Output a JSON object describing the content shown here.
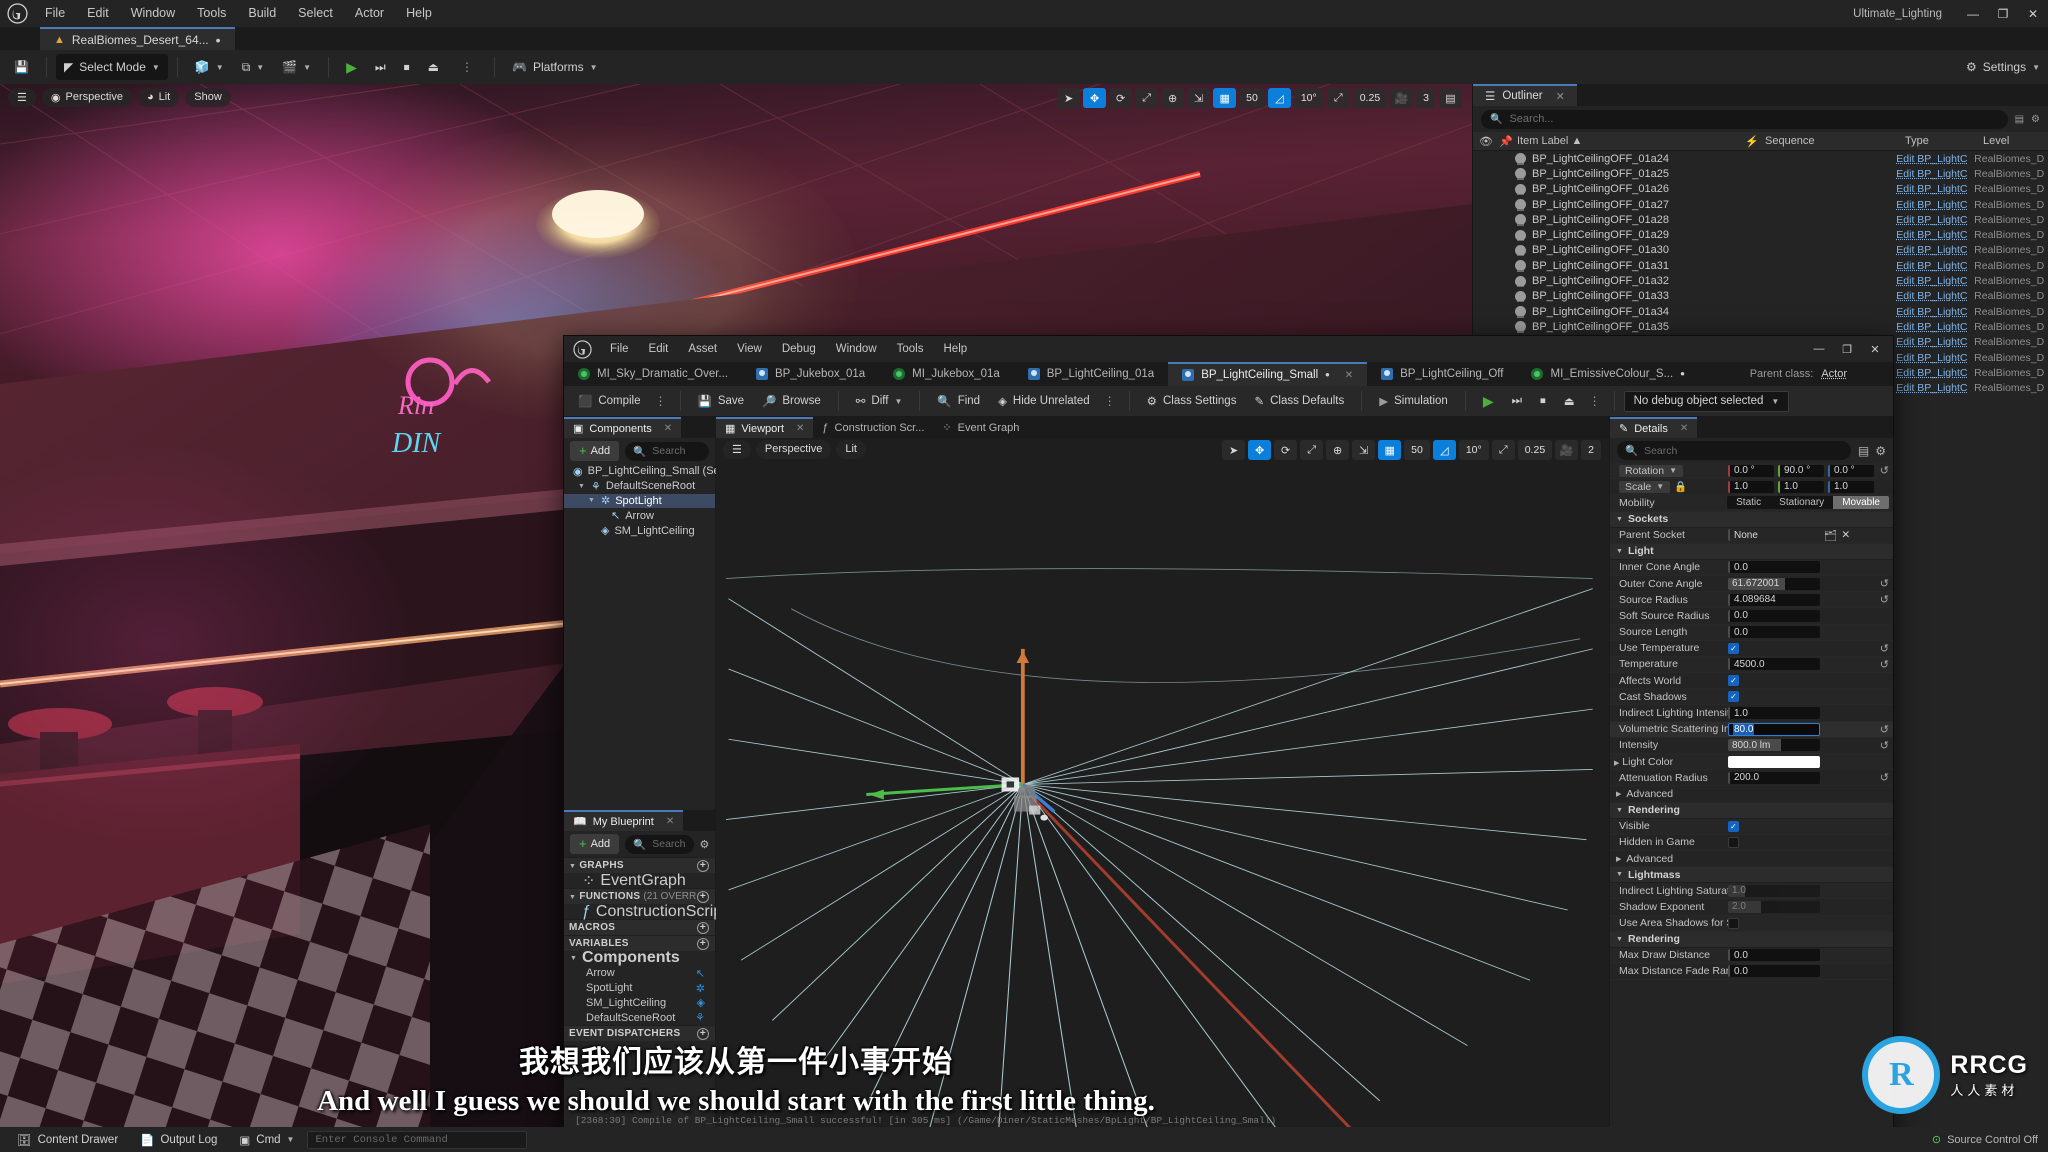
{
  "app": {
    "menu": [
      "File",
      "Edit",
      "Window",
      "Tools",
      "Build",
      "Select",
      "Actor",
      "Help"
    ],
    "level_tab": "RealBiomes_Desert_64...",
    "level_tab_dirty": "•",
    "profile_label": "Ultimate_Lighting",
    "window_controls": {
      "minimize": "—",
      "maximize": "❐",
      "close": "✕"
    }
  },
  "toolbar": {
    "save_label": "",
    "mode_label": "Select Mode",
    "platforms_label": "Platforms",
    "settings_label": "Settings",
    "caret": "⌄"
  },
  "viewport": {
    "perspective": "Perspective",
    "lit": "Lit",
    "show": "Show",
    "grid_value": "50",
    "angle_value": "10°",
    "scale_value": "0.25",
    "camera_value": "3"
  },
  "outliner": {
    "tab_label": "Outliner",
    "close": "✕",
    "search_placeholder": "Search...",
    "columns": [
      "Item Label",
      "Sequence",
      "Type",
      "Level"
    ],
    "sort_arrow": "▲",
    "rows": [
      {
        "label": "BP_LightCeilingOFF_01a24",
        "sequence": "",
        "type": "Edit BP_LightC",
        "level": "RealBiomes_D"
      },
      {
        "label": "BP_LightCeilingOFF_01a25",
        "sequence": "",
        "type": "Edit BP_LightC",
        "level": "RealBiomes_D"
      },
      {
        "label": "BP_LightCeilingOFF_01a26",
        "sequence": "",
        "type": "Edit BP_LightC",
        "level": "RealBiomes_D"
      },
      {
        "label": "BP_LightCeilingOFF_01a27",
        "sequence": "",
        "type": "Edit BP_LightC",
        "level": "RealBiomes_D"
      },
      {
        "label": "BP_LightCeilingOFF_01a28",
        "sequence": "",
        "type": "Edit BP_LightC",
        "level": "RealBiomes_D"
      },
      {
        "label": "BP_LightCeilingOFF_01a29",
        "sequence": "",
        "type": "Edit BP_LightC",
        "level": "RealBiomes_D"
      },
      {
        "label": "BP_LightCeilingOFF_01a30",
        "sequence": "",
        "type": "Edit BP_LightC",
        "level": "RealBiomes_D"
      },
      {
        "label": "BP_LightCeilingOFF_01a31",
        "sequence": "",
        "type": "Edit BP_LightC",
        "level": "RealBiomes_D"
      },
      {
        "label": "BP_LightCeilingOFF_01a32",
        "sequence": "",
        "type": "Edit BP_LightC",
        "level": "RealBiomes_D"
      },
      {
        "label": "BP_LightCeilingOFF_01a33",
        "sequence": "",
        "type": "Edit BP_LightC",
        "level": "RealBiomes_D"
      },
      {
        "label": "BP_LightCeilingOFF_01a34",
        "sequence": "",
        "type": "Edit BP_LightC",
        "level": "RealBiomes_D"
      },
      {
        "label": "BP_LightCeilingOFF_01a35",
        "sequence": "",
        "type": "Edit BP_LightC",
        "level": "RealBiomes_D"
      },
      {
        "label": "",
        "sequence": "",
        "type": "Edit BP_LightC",
        "level": "RealBiomes_D"
      },
      {
        "label": "",
        "sequence": "",
        "type": "Edit BP_LightC",
        "level": "RealBiomes_D"
      },
      {
        "label": "",
        "sequence": "",
        "type": "Edit BP_LightC",
        "level": "RealBiomes_D"
      },
      {
        "label": "",
        "sequence": "",
        "type": "Edit BP_LightC",
        "level": "RealBiomes_D"
      }
    ]
  },
  "blueprint": {
    "menu": [
      "File",
      "Edit",
      "Asset",
      "View",
      "Debug",
      "Window",
      "Tools",
      "Help"
    ],
    "asset_tabs": [
      {
        "label": "MI_Sky_Dramatic_Over...",
        "icon": "material-icon",
        "active": false,
        "dirty": false
      },
      {
        "label": "BP_Jukebox_01a",
        "icon": "blueprint-icon",
        "active": false,
        "dirty": false
      },
      {
        "label": "MI_Jukebox_01a",
        "icon": "material-icon",
        "active": false,
        "dirty": false
      },
      {
        "label": "BP_LightCeiling_01a",
        "icon": "blueprint-icon",
        "active": false,
        "dirty": false
      },
      {
        "label": "BP_LightCeiling_Small",
        "icon": "blueprint-icon",
        "active": true,
        "dirty": true
      },
      {
        "label": "BP_LightCeiling_Off",
        "icon": "blueprint-icon",
        "active": false,
        "dirty": false
      },
      {
        "label": "MI_EmissiveColour_S...",
        "icon": "material-icon",
        "active": false,
        "dirty": true
      }
    ],
    "parent_class_label": "Parent class:",
    "parent_class_value": "Actor",
    "toolbar": {
      "compile": "Compile",
      "save": "Save",
      "browse": "Browse",
      "diff": "Diff",
      "find": "Find",
      "hide_unrelated": "Hide Unrelated",
      "class_settings": "Class Settings",
      "class_defaults": "Class Defaults",
      "simulation": "Simulation",
      "debug_object": "No debug object selected"
    },
    "components": {
      "tab_label": "Components",
      "add_label": "Add",
      "search_placeholder": "Search",
      "tree": [
        {
          "label": "BP_LightCeiling_Small (Self)",
          "depth": 0,
          "icon": "actor-icon",
          "selected": false,
          "twisty": ""
        },
        {
          "label": "DefaultSceneRoot",
          "depth": 1,
          "icon": "scene-root-icon",
          "selected": false,
          "twisty": "▼"
        },
        {
          "label": "SpotLight",
          "depth": 2,
          "icon": "spotlight-icon",
          "selected": true,
          "twisty": "▼"
        },
        {
          "label": "Arrow",
          "depth": 3,
          "icon": "arrow-icon",
          "selected": false,
          "twisty": ""
        },
        {
          "label": "SM_LightCeiling",
          "depth": 2,
          "icon": "static-mesh-icon",
          "selected": false,
          "twisty": ""
        }
      ]
    },
    "my_blueprint": {
      "tab_label": "My Blueprint",
      "add_label": "Add",
      "search_placeholder": "Search",
      "sections": [
        {
          "name": "GRAPHS",
          "suffix": "",
          "items": [
            {
              "label": "EventGraph",
              "icon": "event-graph-icon"
            }
          ]
        },
        {
          "name": "FUNCTIONS",
          "suffix": "(21 OVERR",
          "items": [
            {
              "label": "ConstructionScript",
              "icon": "function-icon"
            }
          ]
        },
        {
          "name": "MACROS",
          "suffix": "",
          "items": []
        },
        {
          "name": "VARIABLES",
          "suffix": "",
          "items": []
        }
      ],
      "components_group": "Components",
      "component_vars": [
        {
          "label": "Arrow",
          "icon": "arrow-icon"
        },
        {
          "label": "SpotLight",
          "icon": "spotlight-icon"
        },
        {
          "label": "SM_LightCeiling",
          "icon": "static-mesh-icon"
        },
        {
          "label": "DefaultSceneRoot",
          "icon": "scene-root-icon"
        }
      ],
      "event_dispatchers": "EVENT DISPATCHERS"
    },
    "viewport_tabs": [
      {
        "label": "Viewport",
        "active": true,
        "closable": true,
        "icon": "viewport-icon"
      },
      {
        "label": "Construction Scr...",
        "active": false,
        "closable": false,
        "icon": "function-icon"
      },
      {
        "label": "Event Graph",
        "active": false,
        "closable": false,
        "icon": "event-graph-icon"
      }
    ],
    "viewport": {
      "perspective": "Perspective",
      "lit": "Lit",
      "grid_value": "50",
      "angle_value": "10°",
      "scale_value": "0.25",
      "camera_value": "2"
    },
    "details": {
      "tab_label": "Details",
      "close": "✕",
      "search_placeholder": "Search",
      "transform": [
        {
          "name": "Rotation",
          "type": "vector3",
          "values": [
            "0.0 °",
            "90.0 °",
            "0.0 °"
          ],
          "dropdown": "⌄",
          "lock": false,
          "reset": true
        },
        {
          "name": "Scale",
          "type": "vector3",
          "values": [
            "1.0",
            "1.0",
            "1.0"
          ],
          "dropdown": "⌄",
          "lock": true,
          "reset": false
        }
      ],
      "mobility": {
        "label": "Mobility",
        "options": [
          "Static",
          "Stationary",
          "Movable"
        ],
        "selected": "Movable"
      },
      "sections": [
        {
          "title": "Sockets",
          "expanded": true,
          "rows": [
            {
              "name": "Parent Socket",
              "type": "socket",
              "value": "None",
              "reset": false
            }
          ]
        },
        {
          "title": "Light",
          "expanded": true,
          "rows": [
            {
              "name": "Inner Cone Angle",
              "type": "number",
              "value": "0.0",
              "reset": false
            },
            {
              "name": "Outer Cone Angle",
              "type": "slider",
              "value": "61.672001",
              "fill": 62,
              "reset": true
            },
            {
              "name": "Source Radius",
              "type": "number",
              "value": "4.089684",
              "reset": true
            },
            {
              "name": "Soft Source Radius",
              "type": "number",
              "value": "0.0",
              "reset": false
            },
            {
              "name": "Source Length",
              "type": "number",
              "value": "0.0",
              "reset": false
            },
            {
              "name": "Use Temperature",
              "type": "check",
              "value": true,
              "reset": true
            },
            {
              "name": "Temperature",
              "type": "number",
              "value": "4500.0",
              "reset": true
            },
            {
              "name": "Affects World",
              "type": "check",
              "value": true,
              "reset": false
            },
            {
              "name": "Cast Shadows",
              "type": "check",
              "value": true,
              "reset": false
            },
            {
              "name": "Indirect Lighting Intensity",
              "type": "number",
              "value": "1.0",
              "reset": false
            },
            {
              "name": "Volumetric Scattering Intensity",
              "type": "editing",
              "value": "80.0",
              "reset": true
            },
            {
              "name": "Intensity",
              "type": "slider",
              "value": "800.0 lm",
              "fill": 58,
              "reset": true
            },
            {
              "name": "Light Color",
              "type": "color",
              "value": "#ffffff",
              "expandable": true,
              "reset": false
            },
            {
              "name": "Attenuation Radius",
              "type": "number",
              "value": "200.0",
              "reset": true
            },
            {
              "name": "Advanced",
              "type": "subsection",
              "value": "",
              "reset": false
            }
          ]
        },
        {
          "title": "Rendering",
          "expanded": true,
          "rows": [
            {
              "name": "Visible",
              "type": "check",
              "value": true,
              "reset": false
            },
            {
              "name": "Hidden in Game",
              "type": "check",
              "value": false,
              "reset": false
            },
            {
              "name": "Advanced",
              "type": "subsection",
              "value": "",
              "reset": false
            }
          ]
        },
        {
          "title": "Lightmass",
          "expanded": true,
          "rows": [
            {
              "name": "Indirect Lighting Saturation",
              "type": "slider-dim",
              "value": "1.0",
              "fill": 18,
              "reset": false
            },
            {
              "name": "Shadow Exponent",
              "type": "slider-dim",
              "value": "2.0",
              "fill": 36,
              "reset": false
            },
            {
              "name": "Use Area Shadows for Station...",
              "type": "check",
              "value": false,
              "reset": false
            }
          ]
        },
        {
          "title": "Rendering",
          "expanded": true,
          "rows": [
            {
              "name": "Max Draw Distance",
              "type": "number",
              "value": "0.0",
              "reset": false
            },
            {
              "name": "Max Distance Fade Range",
              "type": "number",
              "value": "0.0",
              "reset": false
            }
          ]
        }
      ]
    },
    "log_line": "[2368:30] Compile of BP_LightCeiling_Small successful! [in 305 ms] (/Game/Diner/StaticMeshes/BpLight/BP_LightCeiling_Small)"
  },
  "status_bar": {
    "content_drawer": "Content Drawer",
    "output_log": "Output Log",
    "cmd": "Cmd",
    "console_placeholder": "Enter Console Command",
    "source_control": "Source Control Off"
  },
  "subtitles": {
    "chinese": "我想我们应该从第一件小事开始",
    "english": "And well I guess we should we should start with the first little thing."
  },
  "watermark": {
    "mark": "R",
    "title": "RRCG",
    "subtitle": "人人素材"
  },
  "colors": {
    "accent_blue": "#0c7fdb",
    "tab_highlight": "#4a7ab8",
    "selection": "#3c4b63",
    "compile_green": "#4caf3a",
    "panel_bg": "#242424",
    "dark_bg": "#1b1b1b"
  }
}
